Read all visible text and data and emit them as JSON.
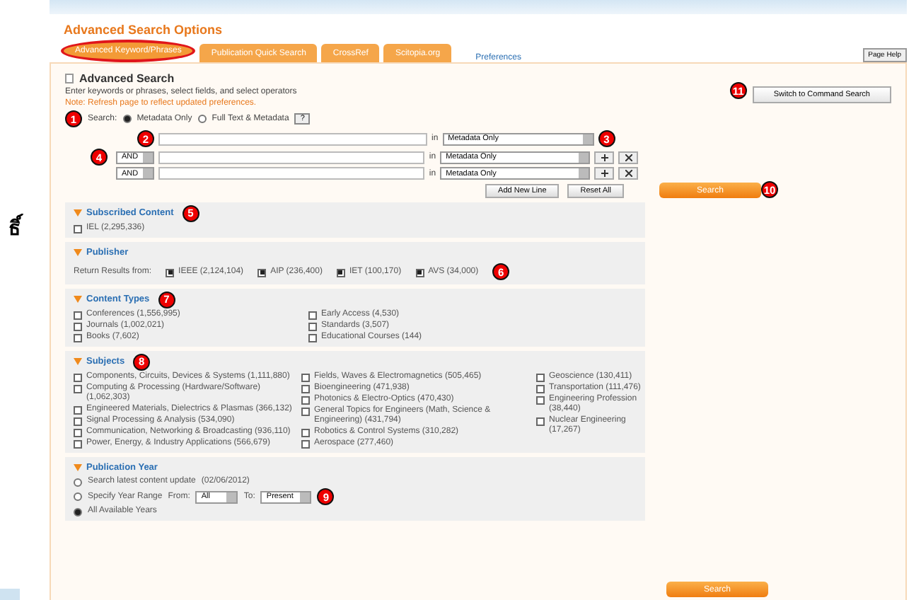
{
  "side_glyph": "ธิ์",
  "page_title": "Advanced Search Options",
  "tabs": [
    {
      "label": "Advanced Keyword/Phrases",
      "selected": true
    },
    {
      "label": "Publication Quick Search",
      "selected": false
    },
    {
      "label": "CrossRef",
      "selected": false
    },
    {
      "label": "Scitopia.org",
      "selected": false
    }
  ],
  "preferences_link": "Preferences",
  "page_help": "Page Help",
  "panel": {
    "title": "Advanced Search",
    "instructions": "Enter keywords or phrases, select fields, and select operators",
    "note": "Note: Refresh page to reflect updated preferences.",
    "switch_button": "Switch to Command Search"
  },
  "search_scope": {
    "label": "Search:",
    "help": "?",
    "options": [
      {
        "label": "Metadata Only",
        "selected": true
      },
      {
        "label": "Full Text & Metadata",
        "selected": false
      }
    ]
  },
  "query_rows": [
    {
      "kind": "first",
      "in_label": "in",
      "field": "Metadata Only"
    },
    {
      "kind": "extra",
      "operator": "AND",
      "in_label": "in",
      "field": "Metadata Only"
    },
    {
      "kind": "extra",
      "operator": "AND",
      "in_label": "in",
      "field": "Metadata Only"
    }
  ],
  "query_buttons": [
    "Add New Line",
    "Reset All"
  ],
  "search_buttons": [
    "Search",
    "Search"
  ],
  "sections": [
    {
      "kind": "columns",
      "title": "Subscribed Content",
      "expanded": true,
      "columns": [
        [
          {
            "label": "IEL (2,295,336)",
            "checked": false
          }
        ]
      ]
    },
    {
      "kind": "inline",
      "title": "Publisher",
      "expanded": true,
      "lead": "Return Results from:",
      "columns": [
        [
          {
            "label": "IEEE (2,124,104)",
            "checked": true
          },
          {
            "label": "AIP (236,400)",
            "checked": true
          },
          {
            "label": "IET (100,170)",
            "checked": true
          },
          {
            "label": "AVS (34,000)",
            "checked": true
          }
        ]
      ]
    },
    {
      "kind": "columns",
      "title": "Content Types",
      "expanded": true,
      "columns": [
        [
          {
            "label": "Conferences (1,556,995)",
            "checked": false
          },
          {
            "label": "Journals (1,002,021)",
            "checked": false
          },
          {
            "label": "Books (7,602)",
            "checked": false
          }
        ],
        [
          {
            "label": "Early Access (4,530)",
            "checked": false
          },
          {
            "label": "Standards (3,507)",
            "checked": false
          },
          {
            "label": "Educational Courses (144)",
            "checked": false
          }
        ]
      ]
    },
    {
      "kind": "columns",
      "title": "Subjects",
      "expanded": true,
      "columns": [
        [
          {
            "label": "Components, Circuits, Devices & Systems (1,111,880)",
            "checked": false
          },
          {
            "label": "Computing & Processing (Hardware/Software) (1,062,303)",
            "checked": false
          },
          {
            "label": "Engineered Materials, Dielectrics & Plasmas (366,132)",
            "checked": false
          },
          {
            "label": "Signal Processing & Analysis (534,090)",
            "checked": false
          },
          {
            "label": "Communication, Networking & Broadcasting (936,110)",
            "checked": false
          },
          {
            "label": "Power, Energy, & Industry Applications (566,679)",
            "checked": false
          }
        ],
        [
          {
            "label": "Fields, Waves & Electromagnetics (505,465)",
            "checked": false
          },
          {
            "label": "Bioengineering (471,938)",
            "checked": false
          },
          {
            "label": "Photonics & Electro-Optics (470,430)",
            "checked": false
          },
          {
            "label": "General Topics for Engineers (Math, Science & Engineering) (431,794)",
            "checked": false
          },
          {
            "label": "Robotics & Control Systems (310,282)",
            "checked": false
          },
          {
            "label": "Aerospace (277,460)",
            "checked": false
          }
        ],
        [
          {
            "label": "Geoscience (130,411)",
            "checked": false
          },
          {
            "label": "Transportation (111,476)",
            "checked": false
          },
          {
            "label": "Engineering Profession (38,440)",
            "checked": false
          },
          {
            "label": "Nuclear Engineering (17,267)",
            "checked": false
          }
        ]
      ]
    },
    {
      "kind": "radios",
      "title": "Publication Year",
      "expanded": true,
      "options": [
        {
          "kind": "plain",
          "label": "Search latest content update",
          "note": "(02/06/2012)",
          "selected": false
        },
        {
          "kind": "range",
          "label": "Specify Year Range",
          "from_label": "From:",
          "from": "All",
          "to_label": "To:",
          "to": "Present",
          "selected": false
        },
        {
          "kind": "plain",
          "label": "All Available Years",
          "selected": true
        }
      ]
    }
  ],
  "callouts": [
    "1",
    "2",
    "3",
    "4",
    "5",
    "6",
    "7",
    "8",
    "9",
    "10",
    "11"
  ]
}
